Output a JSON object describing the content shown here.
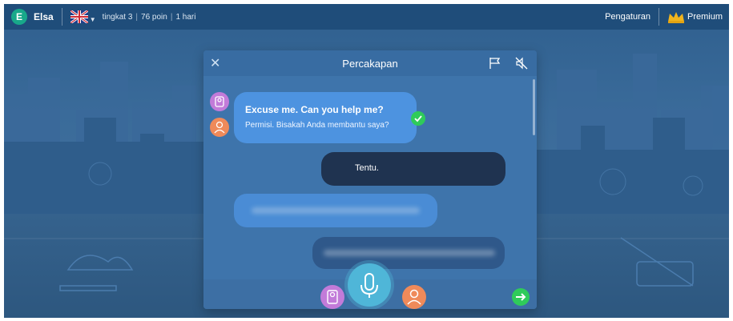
{
  "topbar": {
    "avatar_letter": "E",
    "username": "Elsa",
    "level": "tingkat 3",
    "points": "76 poin",
    "days": "1 hari",
    "settings_label": "Pengaturan",
    "premium_label": "Premium"
  },
  "dialog": {
    "title": "Percakapan",
    "messages": [
      {
        "speaker": "app",
        "text": "Excuse me. Can you help me?",
        "translation": "Permisi. Bisakah Anda membantu saya?",
        "status": "correct"
      },
      {
        "speaker": "user",
        "text": "Tentu."
      },
      {
        "speaker": "app",
        "text": "",
        "blurred": true
      },
      {
        "speaker": "user",
        "text": "",
        "blurred": true
      }
    ]
  },
  "icons": {
    "close": "close-icon",
    "flag": "flag-icon",
    "mute": "speaker-mute-icon",
    "mic": "microphone-icon",
    "next": "arrow-right-icon"
  },
  "colors": {
    "accent_green": "#2fcb5a",
    "bubble_blue": "#4d93e0",
    "bubble_dark": "#1f3350",
    "mic": "#4fb6d8",
    "avatar_pink": "#c27bd9",
    "avatar_orange": "#ef8a5a"
  }
}
